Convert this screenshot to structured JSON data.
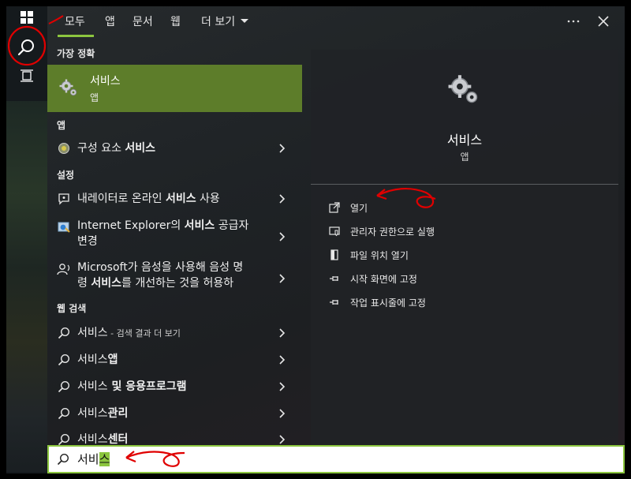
{
  "tabs": [
    {
      "label": "모두"
    },
    {
      "label": "앱"
    },
    {
      "label": "문서"
    },
    {
      "label": "웹"
    },
    {
      "label": "더 보기"
    }
  ],
  "best_match": {
    "section": "가장 정확",
    "title": "서비스",
    "subtitle": "앱"
  },
  "apps": {
    "section": "앱",
    "items": [
      {
        "pre": "구성 요소 ",
        "bold": "서비스",
        "post": ""
      }
    ]
  },
  "settings": {
    "section": "설정",
    "items": [
      {
        "pre": "내레이터로 온라인 ",
        "bold": "서비스",
        "post": " 사용"
      },
      {
        "line1_pre": "Internet Explorer의 ",
        "line1_bold": "서비스",
        "line1_post": " 공급자",
        "line2": "변경"
      },
      {
        "line1": "Microsoft가 음성을 사용해 음성 명",
        "line2_pre": "령 ",
        "line2_bold": "서비스",
        "line2_post": "를 개선하는 것을 허용하"
      }
    ]
  },
  "web": {
    "section": "웹 검색",
    "items": [
      {
        "main": "서비스",
        "suffix": " - 검색 결과 더 보기"
      },
      {
        "main": "서비스",
        "bold": "앱"
      },
      {
        "main": "서비스",
        "bold": " 및 응용프로그램"
      },
      {
        "main": "서비스",
        "bold": "관리"
      },
      {
        "main": "서비스",
        "bold": "센터"
      }
    ]
  },
  "detail": {
    "title": "서비스",
    "subtitle": "앱",
    "actions": [
      {
        "label": "열기",
        "icon": "open-icon"
      },
      {
        "label": "관리자 권한으로 실행",
        "icon": "shield-icon"
      },
      {
        "label": "파일 위치 열기",
        "icon": "file-location-icon"
      },
      {
        "label": "시작 화면에 고정",
        "icon": "pin-icon"
      },
      {
        "label": "작업 표시줄에 고정",
        "icon": "pin-taskbar-icon"
      }
    ]
  },
  "search": {
    "typed": "서비",
    "highlighted": "스"
  },
  "colors": {
    "accent": "#8cc63f",
    "best_match_bg": "#5d7d2a",
    "annotation": "#e00000"
  }
}
